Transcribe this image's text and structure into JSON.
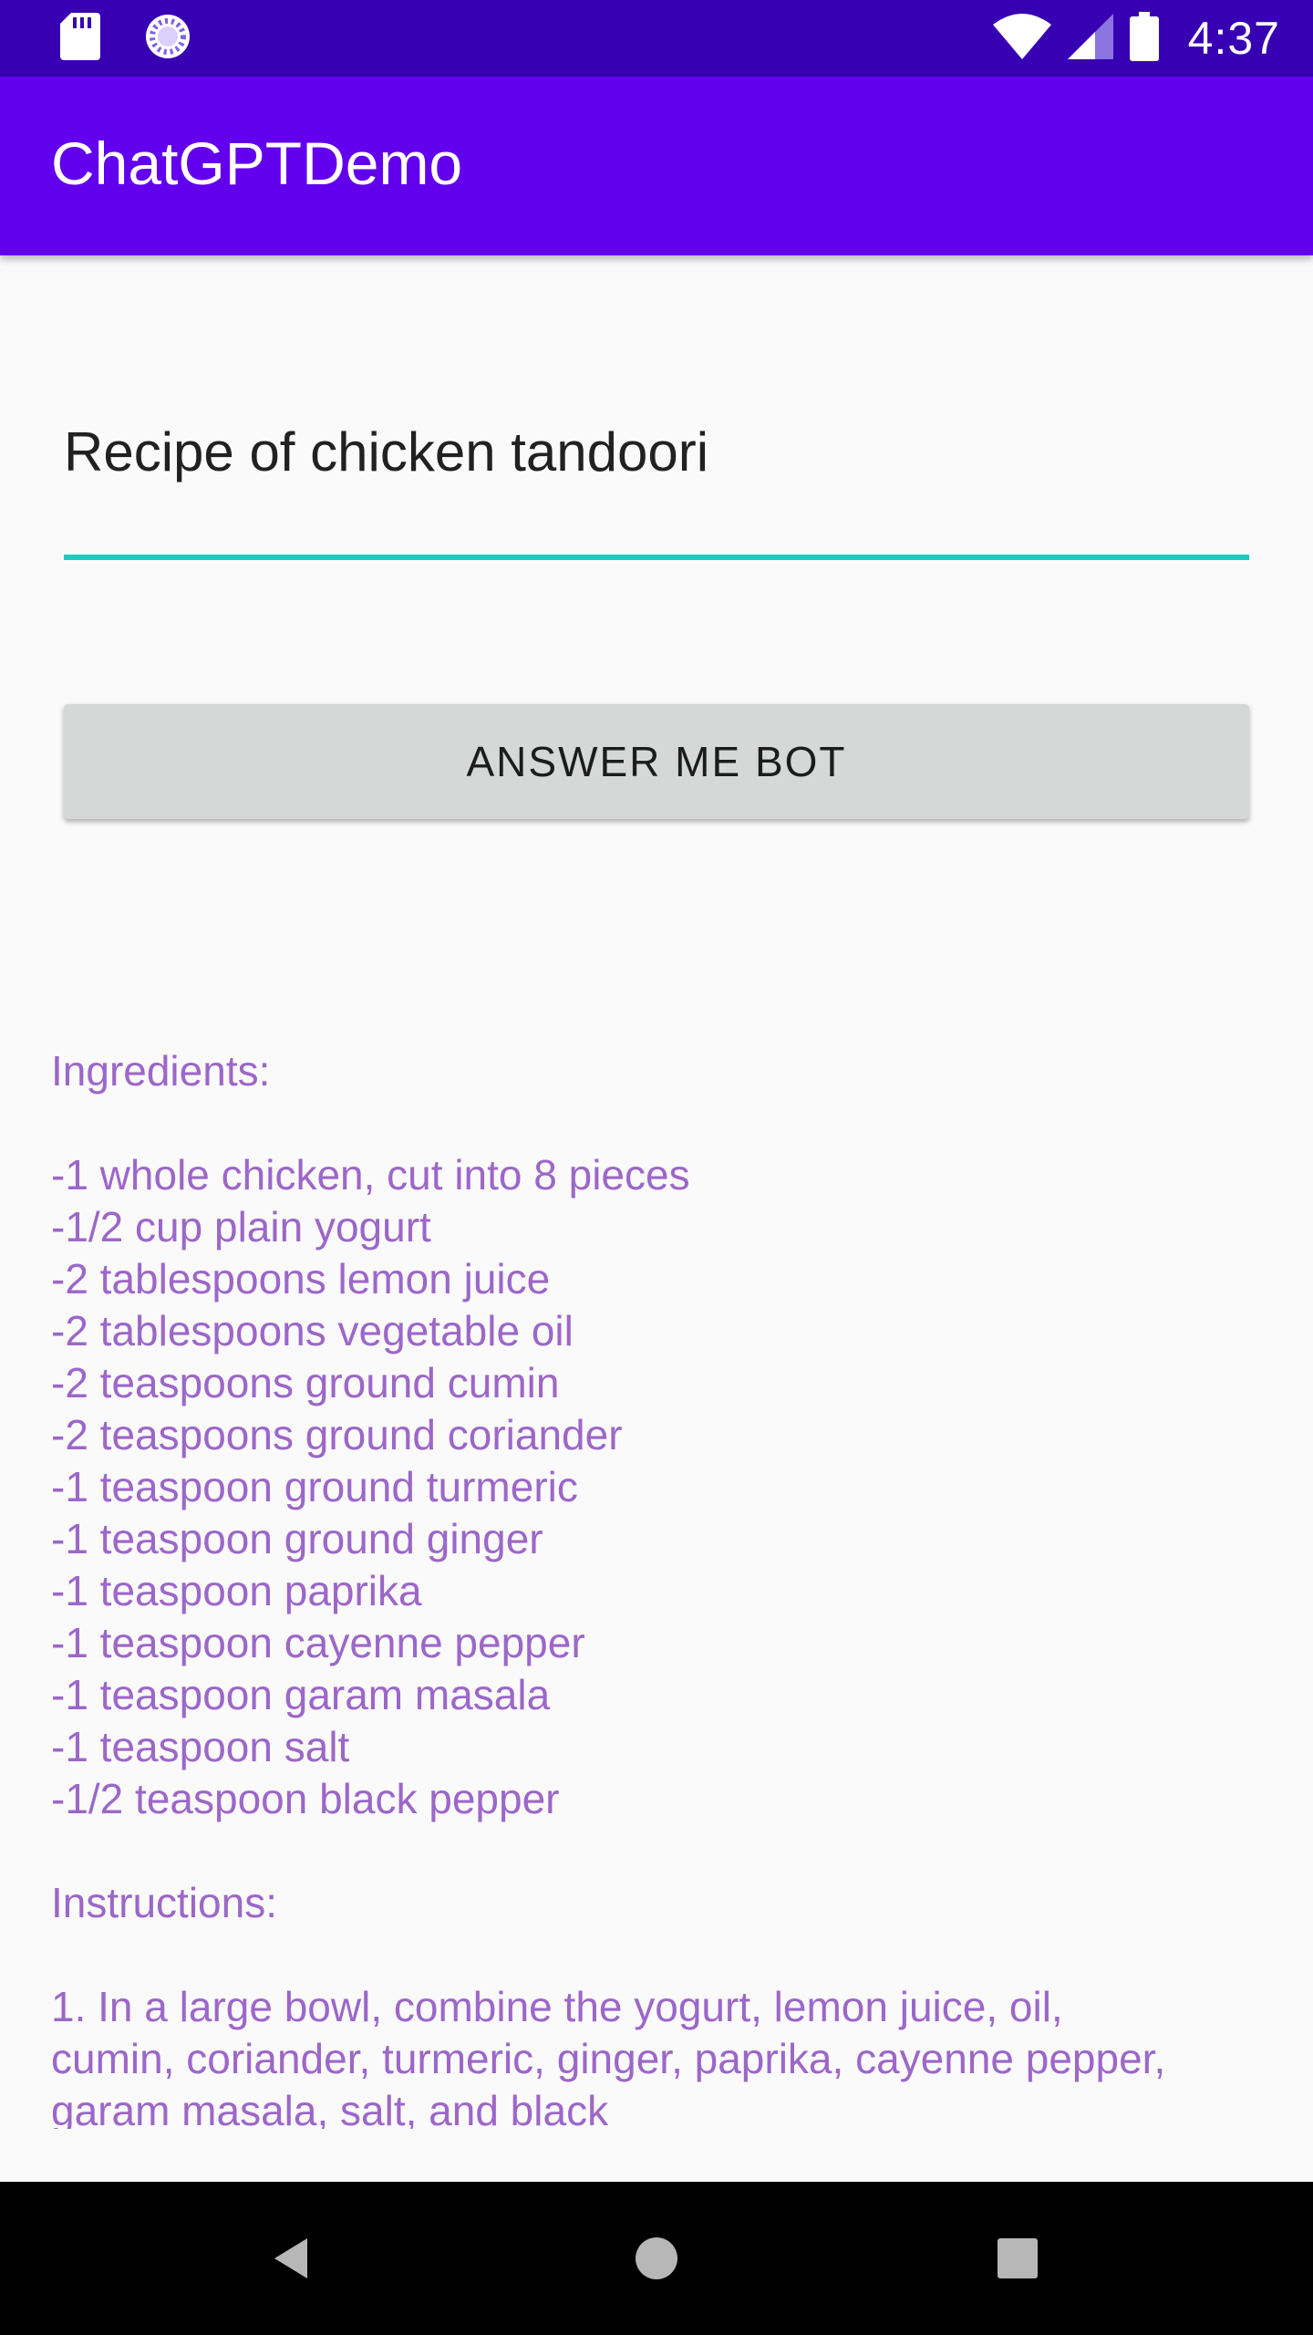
{
  "status_bar": {
    "time": "4:37",
    "icons_left": [
      "sd-card-icon",
      "loading-icon"
    ],
    "icons_right": [
      "wifi-icon",
      "cellular-signal-icon",
      "battery-icon"
    ]
  },
  "app_bar": {
    "title": "ChatGPTDemo"
  },
  "query": {
    "value": "Recipe of chicken tandoori"
  },
  "answer_button": {
    "label": "ANSWER ME BOT"
  },
  "response": {
    "lines": [
      "Ingredients:",
      "",
      "-1 whole chicken, cut into 8 pieces",
      "-1/2 cup plain yogurt",
      "-2 tablespoons lemon juice",
      "-2 tablespoons vegetable oil",
      "-2 teaspoons ground cumin",
      "-2 teaspoons ground coriander",
      "-1 teaspoon ground turmeric",
      "-1 teaspoon ground ginger",
      "-1 teaspoon paprika",
      "-1 teaspoon cayenne pepper",
      "-1 teaspoon garam masala",
      "-1 teaspoon salt",
      "-1/2 teaspoon black pepper",
      "",
      "Instructions:",
      "",
      "1. In a large bowl, combine the yogurt, lemon juice, oil,",
      "cumin, coriander, turmeric, ginger, paprika, cayenne pepper,",
      "garam masala, salt, and black"
    ]
  },
  "nav_bar": {
    "buttons": [
      "back-icon",
      "home-icon",
      "recents-icon"
    ]
  },
  "colors": {
    "status_bar": "#3700b3",
    "app_bar": "#6200ee",
    "accent_underline": "#1fcbc0",
    "response_text": "#9c67c9",
    "button_bg": "#d6d7d7"
  }
}
